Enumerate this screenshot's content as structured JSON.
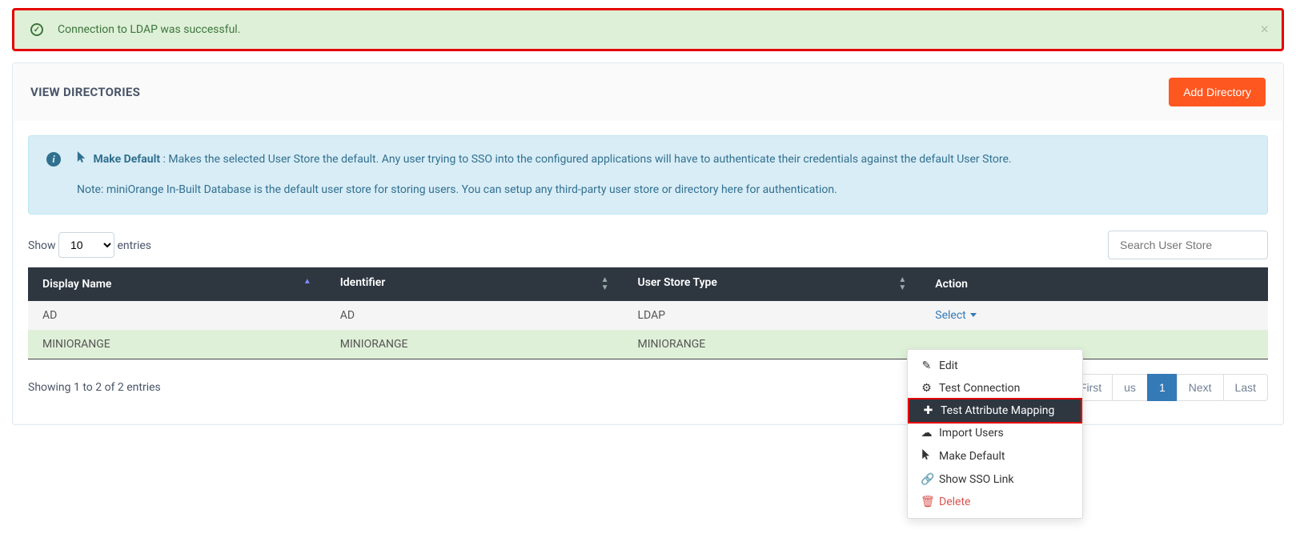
{
  "alert": {
    "message": "Connection to LDAP was successful."
  },
  "panel": {
    "title": "VIEW DIRECTORIES",
    "add_button": "Add Directory"
  },
  "info": {
    "make_default_label": "Make Default",
    "make_default_desc": ": Makes the selected User Store the default. Any user trying to SSO into the configured applications will have to authenticate their credentials against the default User Store.",
    "note": "Note: miniOrange In-Built Database is the default user store for storing users. You can setup any third-party user store or directory here for authentication."
  },
  "table_controls": {
    "show_label": "Show",
    "entries_label": "entries",
    "length_value": "10",
    "search_placeholder": "Search User Store"
  },
  "columns": {
    "display_name": "Display Name",
    "identifier": "Identifier",
    "user_store_type": "User Store Type",
    "action": "Action"
  },
  "rows": [
    {
      "display_name": "AD",
      "identifier": "AD",
      "user_store_type": "LDAP",
      "action_label": "Select"
    },
    {
      "display_name": "MINIORANGE",
      "identifier": "MINIORANGE",
      "user_store_type": "MINIORANGE",
      "action_label": ""
    }
  ],
  "dropdown": {
    "edit": "Edit",
    "test_connection": "Test Connection",
    "test_attribute_mapping": "Test Attribute Mapping",
    "import_users": "Import Users",
    "make_default": "Make Default",
    "show_sso_link": "Show SSO Link",
    "delete": "Delete"
  },
  "footer": {
    "info": "Showing 1 to 2 of 2 entries"
  },
  "pagination": {
    "first": "First",
    "previous": "Previous",
    "page1": "1",
    "next": "Next",
    "last": "Last"
  }
}
